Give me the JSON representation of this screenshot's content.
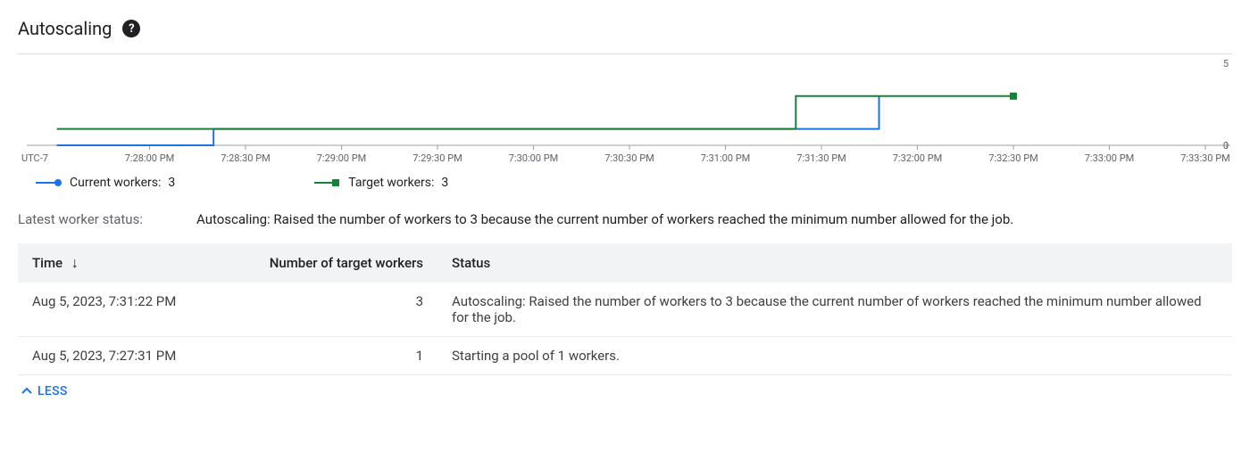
{
  "header": {
    "title": "Autoscaling",
    "help_glyph": "?"
  },
  "chart_data": {
    "type": "line",
    "title": "",
    "xlabel": "UTC-7",
    "ylabel": "",
    "ylim": [
      0,
      5
    ],
    "x_ticks": [
      "7:28:00 PM",
      "7:28:30 PM",
      "7:29:00 PM",
      "7:29:30 PM",
      "7:30:00 PM",
      "7:30:30 PM",
      "7:31:00 PM",
      "7:31:30 PM",
      "7:32:00 PM",
      "7:32:30 PM",
      "7:33:00 PM",
      "7:33:30 PM"
    ],
    "y_ticks": [
      0,
      5
    ],
    "tz_label": "UTC-7",
    "series": [
      {
        "name": "Current workers",
        "color": "#1a73e8",
        "current_value": 3,
        "points": [
          {
            "x": "7:27:31 PM",
            "y": 0
          },
          {
            "x": "7:28:20 PM",
            "y": 0
          },
          {
            "x": "7:28:20 PM",
            "y": 1
          },
          {
            "x": "7:31:48 PM",
            "y": 1
          },
          {
            "x": "7:31:48 PM",
            "y": 3
          }
        ]
      },
      {
        "name": "Target workers",
        "color": "#188038",
        "current_value": 3,
        "points": [
          {
            "x": "7:27:31 PM",
            "y": 1
          },
          {
            "x": "7:31:22 PM",
            "y": 1
          },
          {
            "x": "7:31:22 PM",
            "y": 3
          },
          {
            "x": "7:32:30 PM",
            "y": 3
          }
        ]
      }
    ]
  },
  "legend": {
    "current_label": "Current workers:",
    "current_value": "3",
    "target_label": "Target workers:",
    "target_value": "3"
  },
  "latest_status": {
    "label": "Latest worker status:",
    "text": "Autoscaling: Raised the number of workers to 3 because the current number of workers reached the minimum number allowed for the job."
  },
  "table": {
    "columns": {
      "time": "Time",
      "target": "Number of target workers",
      "status": "Status"
    },
    "rows": [
      {
        "time": "Aug 5, 2023, 7:31:22 PM",
        "target": "3",
        "status": "Autoscaling: Raised the number of workers to 3 because the current number of workers reached the minimum number allowed for the job."
      },
      {
        "time": "Aug 5, 2023, 7:27:31 PM",
        "target": "1",
        "status": "Starting a pool of 1 workers."
      }
    ]
  },
  "less_button": "LESS"
}
